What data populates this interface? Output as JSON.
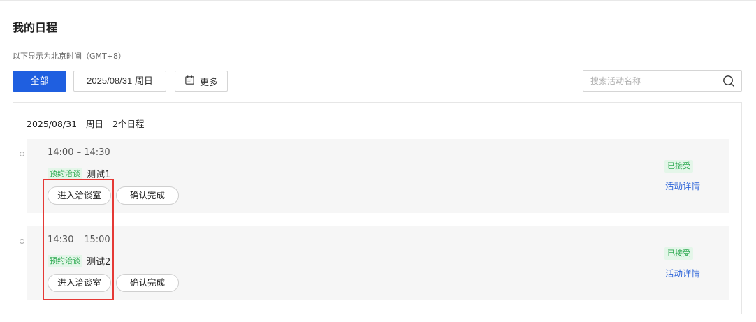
{
  "page": {
    "title": "我的日程",
    "timezone_note": "以下显示为北京时间（GMT+8）"
  },
  "filters": {
    "all_label": "全部",
    "date_label": "2025/08/31 周日",
    "more_label": "更多",
    "more_icon": "calendar-icon",
    "search_placeholder": "搜索活动名称",
    "search_icon": "search-icon"
  },
  "schedule": {
    "day": {
      "date": "2025/08/31",
      "weekday": "周日",
      "count_text": "2个日程"
    },
    "events": [
      {
        "time": "14:00 – 14:30",
        "tag": "预约洽谈",
        "name": "测试1",
        "enter_label": "进入洽谈室",
        "confirm_label": "确认完成",
        "status": "已接受",
        "detail_label": "活动详情"
      },
      {
        "time": "14:30 – 15:00",
        "tag": "预约洽谈",
        "name": "测试2",
        "enter_label": "进入洽谈室",
        "confirm_label": "确认完成",
        "status": "已接受",
        "detail_label": "活动详情"
      }
    ]
  },
  "colors": {
    "primary": "#1f5fe0",
    "tag_green": "#2faa52",
    "tag_green_bg": "#e4f6e9",
    "link_blue": "#2b63d9",
    "highlight_red": "#e53935"
  }
}
